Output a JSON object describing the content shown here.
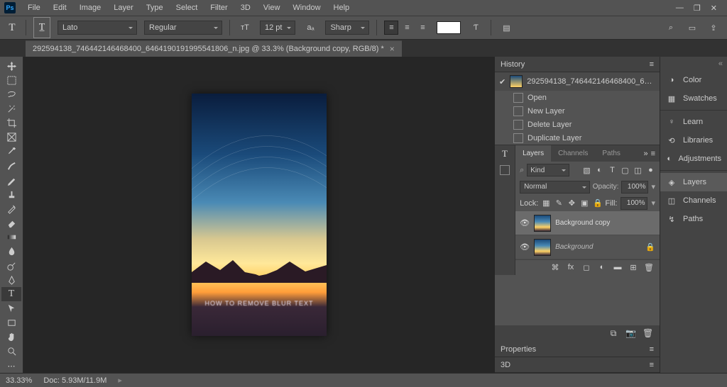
{
  "menubar": {
    "items": [
      "File",
      "Edit",
      "Image",
      "Layer",
      "Type",
      "Select",
      "Filter",
      "3D",
      "View",
      "Window",
      "Help"
    ]
  },
  "window_controls": {
    "min": "—",
    "max": "❐",
    "close": "✕"
  },
  "options_bar": {
    "font_family": "Lato",
    "font_style": "Regular",
    "font_size": "12 pt",
    "anti_alias": "Sharp"
  },
  "document_tab": {
    "title": "292594138_746442146468400_6464190191995541806_n.jpg @ 33.3% (Background copy, RGB/8) *"
  },
  "canvas": {
    "overlay_text": "HOW TO REMOVE BLUR TEXT"
  },
  "history": {
    "title": "History",
    "snapshot": "292594138_746442146468400_6464190191995...",
    "items": [
      "Open",
      "New Layer",
      "Delete Layer",
      "Duplicate Layer"
    ]
  },
  "layers_panel": {
    "tabs": [
      "Layers",
      "Channels",
      "Paths"
    ],
    "filter_label": "Kind",
    "blend_mode": "Normal",
    "opacity_label": "Opacity:",
    "opacity_val": "100%",
    "lock_label": "Lock:",
    "fill_label": "Fill:",
    "fill_val": "100%",
    "layers": [
      {
        "name": "Background copy",
        "locked": false,
        "selected": true
      },
      {
        "name": "Background",
        "locked": true,
        "selected": false,
        "italic": true
      }
    ]
  },
  "far_panel": {
    "items": [
      {
        "label": "Color",
        "icon": "◑"
      },
      {
        "label": "Swatches",
        "icon": "▦"
      },
      {
        "label": "Learn",
        "icon": "♀"
      },
      {
        "label": "Libraries",
        "icon": "⟲"
      },
      {
        "label": "Adjustments",
        "icon": "◐"
      },
      {
        "label": "Layers",
        "icon": "◈",
        "active": true
      },
      {
        "label": "Channels",
        "icon": "◫"
      },
      {
        "label": "Paths",
        "icon": "↯"
      }
    ]
  },
  "properties": {
    "title": "Properties"
  },
  "panel_3d": {
    "title": "3D"
  },
  "status_bar": {
    "zoom": "33.33%",
    "doc": "Doc: 5.93M/11.9M"
  }
}
